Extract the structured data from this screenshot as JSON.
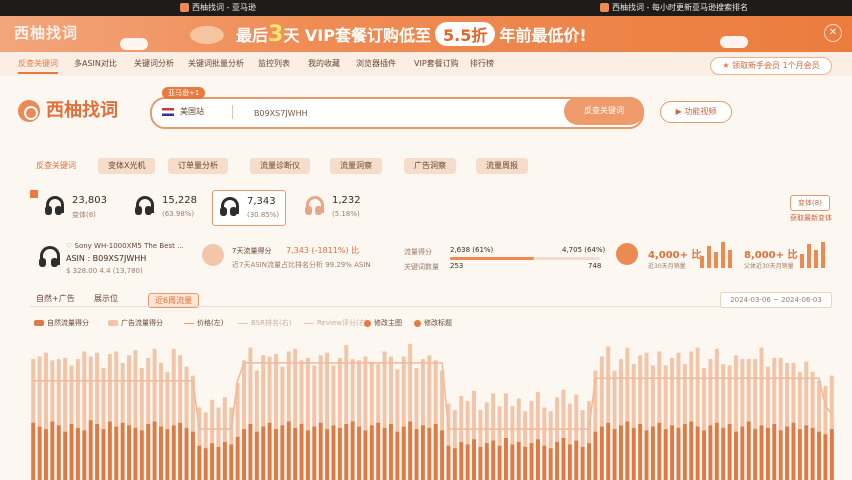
{
  "sysbar": {
    "center": "西柚找词 - 亚马逊",
    "right": "西柚找词 - 每小时更新亚马逊搜索排名"
  },
  "banner": {
    "brand": "西柚找词",
    "promo_pre": "最后",
    "promo_days": "3",
    "promo_day_unit": "天",
    "promo_text": "VIP套餐订购低至",
    "promo_discount": "5.5折",
    "promo_tail": "年前最低价!"
  },
  "nav": {
    "items": [
      "反查关键词",
      "多ASIN对比",
      "关键词分析",
      "关键词批量分析",
      "监控列表",
      "我的收藏",
      "浏览器插件",
      "VIP套餐订购",
      "排行榜"
    ],
    "member": "领取新手会员 1个月会员"
  },
  "logo": {
    "text": "西柚找词"
  },
  "search": {
    "tag": "亚马逊+1",
    "site": "美国站",
    "value": "B09XS7JWHH",
    "button": "反查关键词"
  },
  "howto": "功能视频",
  "subtabs": [
    "反查关键词",
    "变体X光机",
    "订单量分析",
    "流量诊断仪",
    "流量洞察",
    "广告洞察",
    "流量周报"
  ],
  "variants": [
    {
      "num": "23,803",
      "pct": "变体(8)"
    },
    {
      "num": "15,228",
      "pct": "(63.98%)"
    },
    {
      "num": "7,343",
      "pct": "(30.85%)"
    },
    {
      "num": "1,232",
      "pct": "(5.18%)"
    }
  ],
  "variant_btn": "变体(8)",
  "variant_link": "获取最新变体",
  "product": {
    "title": "Sony WH-1000XM5 The Best ...",
    "asin": "ASIN : B09XS7JWHH",
    "price": "$ 328.00  4.4  (13,780)"
  },
  "traffic": {
    "label": "7天流量得分",
    "value": "7,343 (-1811%) 比",
    "sub": "近7天ASIN流量占比排名分析 99.29% ASIN"
  },
  "stats": {
    "kw_label": "流量得分",
    "kw_val": "2,638 (61%)",
    "kw_val2": "4,705 (64%)",
    "kw2_label": "关键词数量",
    "kw2_val": "253",
    "kw2_val2": "748"
  },
  "big1": {
    "value": "4,000+ 比",
    "sub": "近30天月销量"
  },
  "big2": {
    "value": "8,000+ 比",
    "sub": "父体近30天月销量"
  },
  "ctabs": [
    "自然+广告",
    "展示位",
    "近6周流量"
  ],
  "date_range": "2024-03-06  ~  2024-06-03",
  "legend": [
    "自然流量得分",
    "广告流量得分",
    "价格(左)",
    "BSR排名(右)",
    "Review评分(右)",
    "修改主图",
    "修改标题"
  ],
  "colors": {
    "accent": "#e87a3e",
    "natural": "#de7a45",
    "ad": "#f2c4a8",
    "line": "#f0b99a"
  },
  "chart_data": {
    "type": "bar",
    "series": [
      {
        "name": "自然流量得分",
        "values": [
          45,
          42,
          40,
          46,
          43,
          38,
          44,
          41,
          39,
          47,
          44,
          40,
          46,
          42,
          45,
          43,
          41,
          39,
          44,
          46,
          42,
          40,
          43,
          45,
          41,
          38,
          27,
          25,
          29,
          26,
          30,
          28,
          34,
          40,
          44,
          38,
          42,
          45,
          40,
          43,
          46,
          41,
          44,
          39,
          42,
          45,
          40,
          43,
          41,
          44,
          46,
          42,
          39,
          43,
          45,
          41,
          44,
          38,
          42,
          46,
          40,
          43,
          41,
          44,
          39,
          27,
          25,
          30,
          28,
          32,
          26,
          29,
          31,
          27,
          33,
          28,
          30,
          26,
          29,
          32,
          27,
          25,
          30,
          33,
          28,
          31,
          26,
          29,
          38,
          42,
          45,
          40,
          43,
          46,
          41,
          44,
          39,
          42,
          45,
          40,
          43,
          41,
          44,
          46,
          42,
          39,
          43,
          45,
          41,
          44,
          38,
          42,
          46,
          40,
          43,
          41,
          44,
          39,
          42,
          45,
          40,
          43,
          41,
          38,
          36,
          40
        ]
      },
      {
        "name": "广告流量得分",
        "values": [
          50,
          55,
          60,
          48,
          52,
          58,
          46,
          54,
          62,
          50,
          56,
          48,
          53,
          59,
          47,
          55,
          61,
          49,
          52,
          57,
          50,
          45,
          60,
          53,
          48,
          44,
          30,
          28,
          34,
          31,
          35,
          29,
          42,
          54,
          60,
          48,
          56,
          52,
          59,
          46,
          55,
          62,
          50,
          57,
          48,
          53,
          60,
          47,
          55,
          62,
          49,
          52,
          58,
          50,
          46,
          60,
          53,
          49,
          55,
          61,
          48,
          52,
          57,
          50,
          47,
          33,
          30,
          36,
          34,
          38,
          29,
          32,
          37,
          31,
          35,
          30,
          34,
          28,
          33,
          37,
          30,
          29,
          35,
          38,
          32,
          36,
          29,
          33,
          48,
          55,
          60,
          46,
          52,
          58,
          50,
          54,
          61,
          48,
          56,
          50,
          53,
          59,
          47,
          55,
          62,
          49,
          52,
          58,
          50,
          46,
          60,
          53,
          49,
          55,
          61,
          48,
          52,
          57,
          50,
          47,
          45,
          50,
          44,
          40,
          38,
          42
        ]
      },
      {
        "name": "价格(左)",
        "values": [
          78,
          78,
          78,
          78,
          78,
          78,
          78,
          78,
          78,
          78,
          78,
          78,
          78,
          78,
          78,
          78,
          78,
          78,
          78,
          78,
          78,
          78,
          78,
          78,
          78,
          78,
          40,
          40,
          40,
          40,
          40,
          40,
          78,
          92,
          92,
          92,
          92,
          92,
          92,
          92,
          92,
          92,
          92,
          92,
          92,
          92,
          92,
          92,
          92,
          92,
          92,
          92,
          92,
          92,
          92,
          92,
          92,
          92,
          92,
          92,
          92,
          92,
          92,
          92,
          92,
          40,
          40,
          40,
          40,
          40,
          40,
          40,
          40,
          40,
          40,
          40,
          40,
          40,
          40,
          40,
          40,
          40,
          40,
          40,
          40,
          40,
          40,
          40,
          80,
          80,
          80,
          80,
          80,
          80,
          80,
          80,
          80,
          80,
          80,
          80,
          80,
          80,
          80,
          80,
          80,
          80,
          80,
          80,
          80,
          80,
          80,
          80,
          80,
          80,
          80,
          80,
          80,
          80,
          80,
          80,
          80,
          80,
          80,
          80,
          58,
          52,
          50,
          48
        ]
      }
    ],
    "ylim": [
      0,
      110
    ]
  }
}
